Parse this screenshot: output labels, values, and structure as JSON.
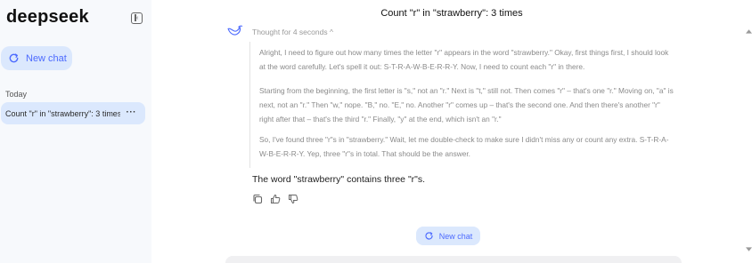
{
  "sidebar": {
    "logo": "deepseek",
    "new_chat_label": "New chat",
    "section_label": "Today",
    "conversations": [
      {
        "label": "Count \"r\" in \"strawberry\": 3 times",
        "more": "···"
      }
    ]
  },
  "chat": {
    "title": "Count \"r\" in \"strawberry\": 3 times",
    "thought_toggle": "Thought for 4 seconds ^",
    "thinking": [
      "Alright, I need to figure out how many times the letter \"r\" appears in the word \"strawberry.\" Okay, first things first, I should look at the word carefully. Let's spell it out: S-T-R-A-W-B-E-R-R-Y. Now, I need to count each \"r\" in there.",
      "Starting from the beginning, the first letter is \"s,\" not an \"r.\" Next is \"t,\" still not. Then comes \"r\" – that's one \"r.\" Moving on, \"a\" is next, not an \"r.\" Then \"w,\" nope. \"B,\" no. \"E,\" no. Another \"r\" comes up – that's the second one. And then there's another \"r\" right after that – that's the third \"r.\" Finally, \"y\" at the end, which isn't an \"r.\"",
      "So, I've found three \"r\"s in \"strawberry.\" Wait, let me double-check to make sure I didn't miss any or count any extra. S-T-R-A-W-B-E-R-R-Y. Yep, three \"r\"s in total. That should be the answer."
    ],
    "answer": "The word \"strawberry\" contains three \"r\"s.",
    "actions": [
      "copy-icon",
      "thumbs-up-icon",
      "thumbs-down-icon"
    ],
    "new_chat_label": "New chat"
  },
  "colors": {
    "accent": "#4d6bfe",
    "accent_bg": "#dbe8fd",
    "sidebar_bg": "#f7f9fc"
  }
}
